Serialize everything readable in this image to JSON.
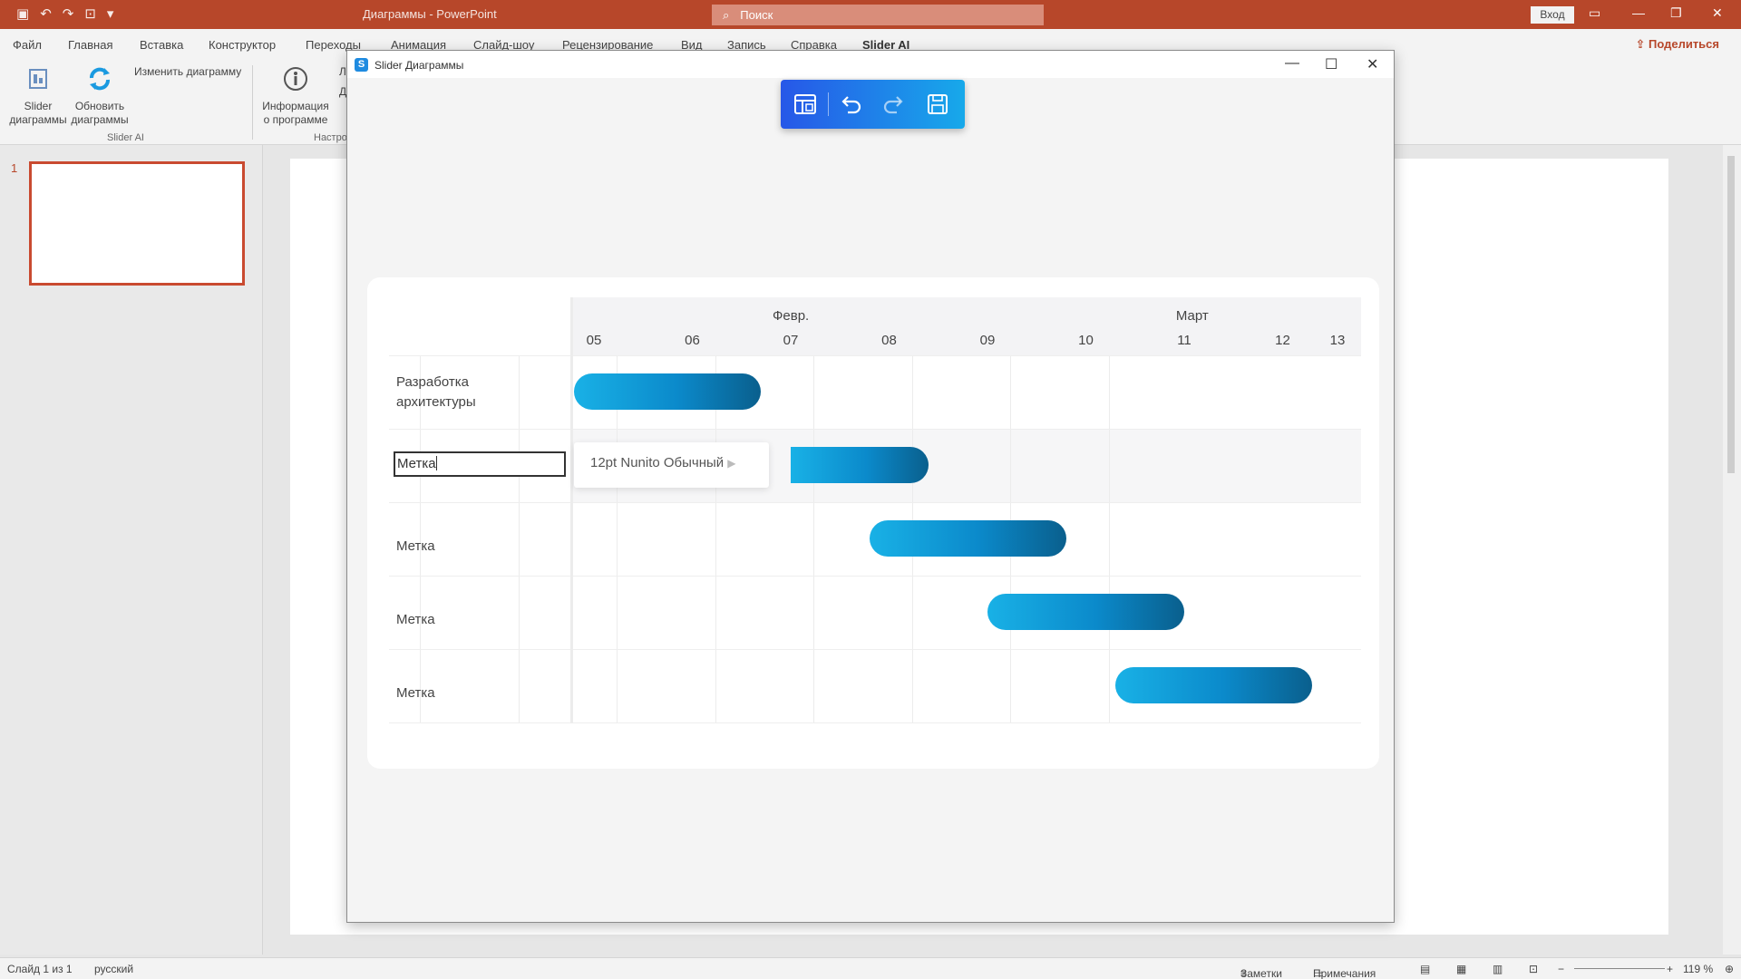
{
  "app": {
    "doc_title": "Диаграммы - PowerPoint",
    "search_placeholder": "Поиск",
    "signin": "Вход",
    "share": "Поделиться"
  },
  "tabs": [
    "Файл",
    "Главная",
    "Вставка",
    "Конструктор",
    "Переходы",
    "Анимация",
    "Слайд-шоу",
    "Рецензирование",
    "Вид",
    "Запись",
    "Справка",
    "Slider AI"
  ],
  "ribbon": {
    "slider_diagrams": [
      "Slider",
      "диаграммы"
    ],
    "refresh_diagrams": [
      "Обновить",
      "диаграммы"
    ],
    "edit_diagram": "Изменить диаграмму",
    "info": [
      "Информация",
      "о программе"
    ],
    "group_slider_ai": "Slider AI",
    "group_settings": "Настро",
    "cut_letters": [
      "Л",
      "Д"
    ]
  },
  "thumbnails": {
    "slide_number": "1"
  },
  "dialog": {
    "title": "Slider Диаграммы",
    "logo_letter": "S"
  },
  "gantt": {
    "months": [
      {
        "label": "Февр.",
        "day": 7
      },
      {
        "label": "Март",
        "day": 11.1
      }
    ],
    "days": [
      "05",
      "06",
      "07",
      "08",
      "09",
      "10",
      "11",
      "12",
      "13"
    ],
    "rows": [
      {
        "label": "Разработка архитектуры",
        "start": 4.8,
        "end": 6.7
      },
      {
        "label": "Метка",
        "start": 7.0,
        "end": 8.4,
        "editing": true
      },
      {
        "label": "Метка",
        "start": 7.8,
        "end": 9.8
      },
      {
        "label": "Метка",
        "start": 9.0,
        "end": 11.0
      },
      {
        "label": "Метка",
        "start": 10.3,
        "end": 12.3
      }
    ],
    "editing_value": "Метка",
    "font_popup": "12pt Nunito Обычный"
  },
  "status": {
    "slide": "Слайд 1 из 1",
    "language": "русский",
    "notes": "Заметки",
    "comments": "Примечания",
    "zoom": "119 %"
  },
  "colors": {
    "accent": "#b7472a",
    "bar_start": "#19b1e6",
    "bar_end": "#0a5f8d",
    "toolbar_start": "#2757e8",
    "toolbar_end": "#17a9ea"
  }
}
